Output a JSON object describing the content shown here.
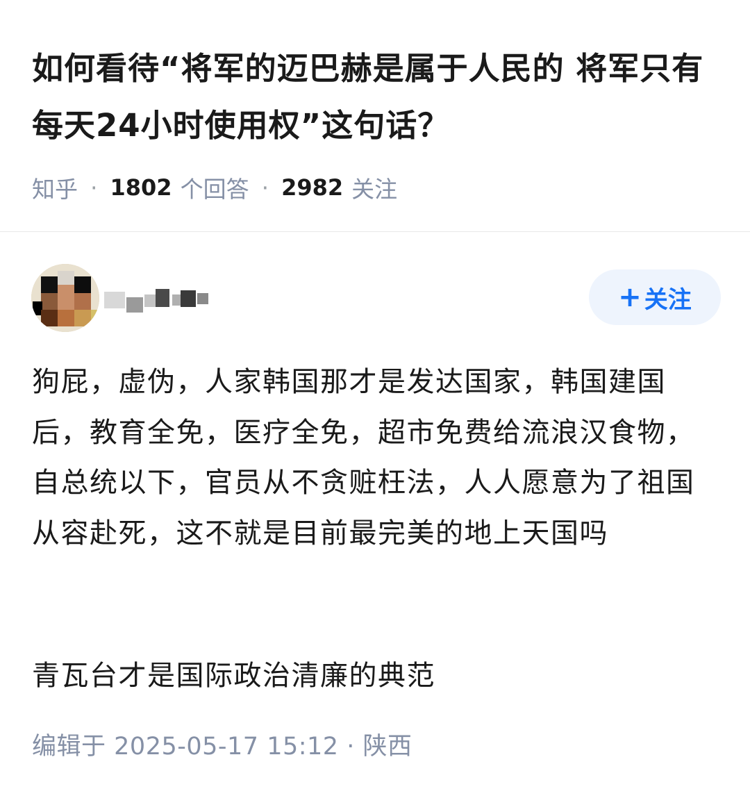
{
  "question": {
    "title": "如何看待“将军的迈巴赫是属于人民的 将军只有每天24小时使用权”这句话？",
    "source": "知乎",
    "answer_count": "1802",
    "answer_label": "个回答",
    "follower_count": "2982",
    "follower_label": "关注"
  },
  "author": {
    "follow_button_label": "关注",
    "follow_button_icon": "plus-icon"
  },
  "answer": {
    "paragraph1": "狗屁，虚伪，人家韩国那才是发达国家，韩国建国后，教育全免，医疗全免，超市免费给流浪汉食物，自总统以下，官员从不贪赃枉法，人人愿意为了祖国从容赴死，这不就是目前最完美的地上天国吗",
    "paragraph2": "青瓦台才是国际政治清廉的典范",
    "edit_label": "编辑于",
    "edit_date": "2025-05-17",
    "edit_time": "15:12",
    "location": "陕西"
  },
  "colors": {
    "accent": "#1772f6",
    "follow_bg": "#eef4fd",
    "meta_gray": "#8590a6",
    "text": "#1a1a1a"
  }
}
